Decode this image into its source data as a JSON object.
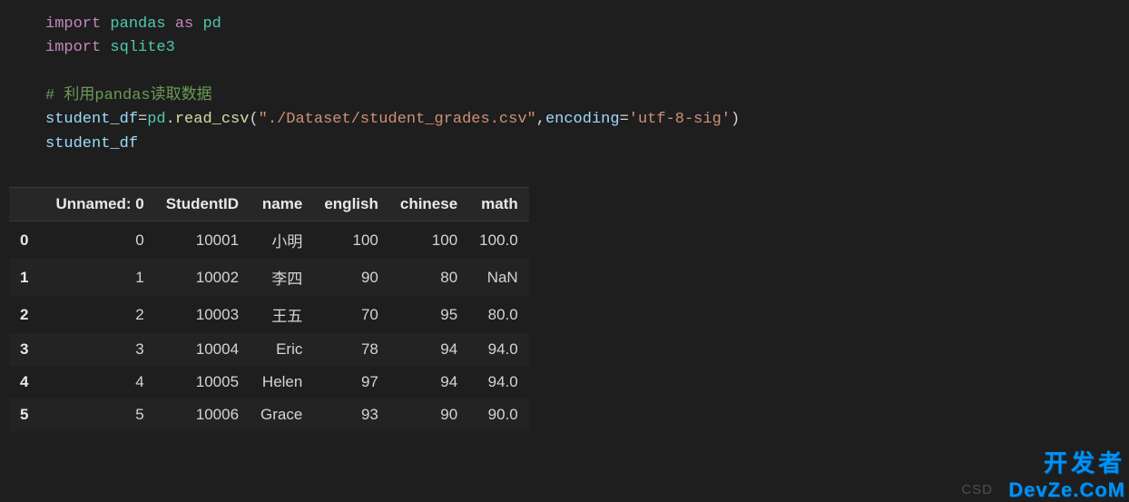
{
  "code": {
    "line1": {
      "kw1": "import",
      "mod1": "pandas",
      "kw2": "as",
      "alias": "pd"
    },
    "line2": {
      "kw1": "import",
      "mod1": "sqlite3"
    },
    "line4": {
      "comment": "# 利用pandas读取数据"
    },
    "line5": {
      "var": "student_df",
      "eq": "=",
      "obj": "pd",
      "dot": ".",
      "fn": "read_csv",
      "open": "(",
      "str1": "\"./Dataset/student_grades.csv\"",
      "comma": ",",
      "kw": "encoding",
      "eq2": "=",
      "str2": "'utf-8-sig'",
      "close": ")"
    },
    "line6": {
      "var": "student_df"
    }
  },
  "table": {
    "headers": [
      "Unnamed: 0",
      "StudentID",
      "name",
      "english",
      "chinese",
      "math"
    ],
    "rows": [
      {
        "idx": "0",
        "c0": "0",
        "c1": "10001",
        "c2": "小明",
        "c3": "100",
        "c4": "100",
        "c5": "100.0"
      },
      {
        "idx": "1",
        "c0": "1",
        "c1": "10002",
        "c2": "李四",
        "c3": "90",
        "c4": "80",
        "c5": "NaN"
      },
      {
        "idx": "2",
        "c0": "2",
        "c1": "10003",
        "c2": "王五",
        "c3": "70",
        "c4": "95",
        "c5": "80.0"
      },
      {
        "idx": "3",
        "c0": "3",
        "c1": "10004",
        "c2": "Eric",
        "c3": "78",
        "c4": "94",
        "c5": "94.0"
      },
      {
        "idx": "4",
        "c0": "4",
        "c1": "10005",
        "c2": "Helen",
        "c3": "97",
        "c4": "94",
        "c5": "94.0"
      },
      {
        "idx": "5",
        "c0": "5",
        "c1": "10006",
        "c2": "Grace",
        "c3": "93",
        "c4": "90",
        "c5": "90.0"
      }
    ]
  },
  "watermark": {
    "cn": "开发者",
    "en": "DevZe.CoM",
    "csd": "CSD"
  }
}
